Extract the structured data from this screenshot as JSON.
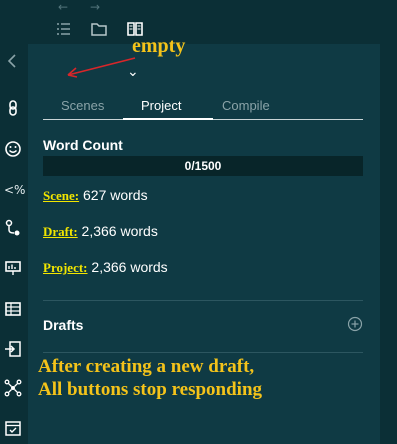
{
  "window": {
    "nav": {
      "back": "←",
      "forward": "→"
    },
    "toolbar": {
      "icons": [
        "list-icon",
        "folder-icon",
        "book-icon"
      ]
    },
    "leftbar": {
      "icons": [
        "chevron-left-icon",
        "link-icon",
        "smile-icon",
        "percent-icon",
        "branch-icon",
        "presentation-icon",
        "table-icon",
        "import-icon",
        "network-icon",
        "calendar-icon"
      ],
      "percent_glyph": "<%"
    }
  },
  "panel": {
    "tabs": [
      {
        "label": "Scenes",
        "active": false
      },
      {
        "label": "Project",
        "active": true
      },
      {
        "label": "Compile",
        "active": false
      }
    ],
    "word_count": {
      "title": "Word Count",
      "progress_text": "0/1500",
      "progress": 0.0
    },
    "stats": [
      {
        "label": "Scene:",
        "value": "627 words"
      },
      {
        "label": "Draft:",
        "value": "2,366 words"
      },
      {
        "label": "Project:",
        "value": "2,366 words"
      }
    ],
    "drafts": {
      "title": "Drafts",
      "add_icon": "plus-circle-icon"
    }
  },
  "annotations": {
    "empty": "empty",
    "note_line1": "After creating a new draft,",
    "note_line2": "All buttons stop responding",
    "arrow_color": "#d7262a",
    "text_color": "#f4c31a"
  },
  "colors": {
    "background": "#0b2f36",
    "panel": "#0f3a44",
    "accent_label": "#f2e600"
  }
}
